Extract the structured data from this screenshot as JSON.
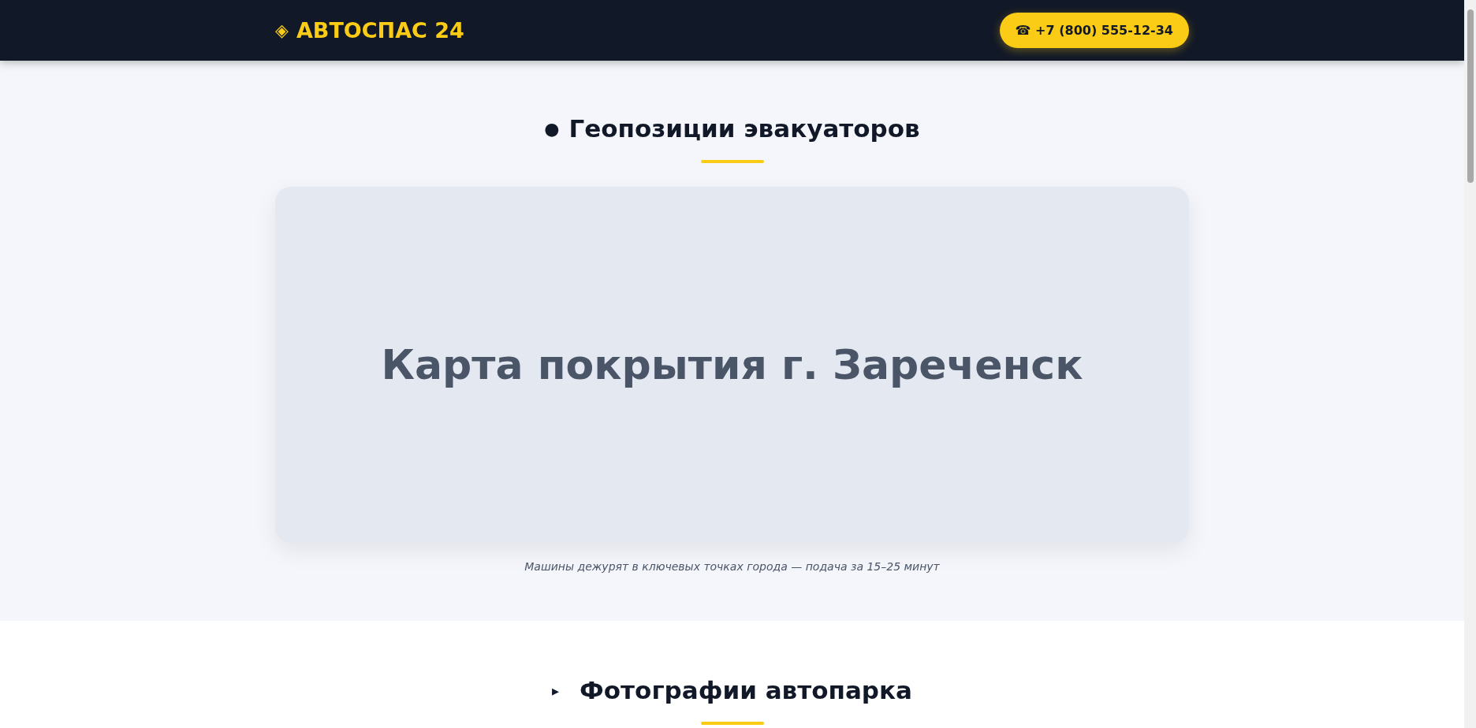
{
  "header": {
    "logo_icon": "◈",
    "logo": "АВТОСПАС 24",
    "phone_icon": "☎",
    "phone": "+7 (800) 555-12-34"
  },
  "sections": [
    {
      "icon": "●",
      "title": "Геопозиции эвакуаторов",
      "map_label": "Карта покрытия г. Зареченск",
      "caption": "Машины дежурят в ключевых точках города — подача за 15–25 минут"
    },
    {
      "icon": "▸",
      "title": "Фотографии автопарка"
    }
  ]
}
